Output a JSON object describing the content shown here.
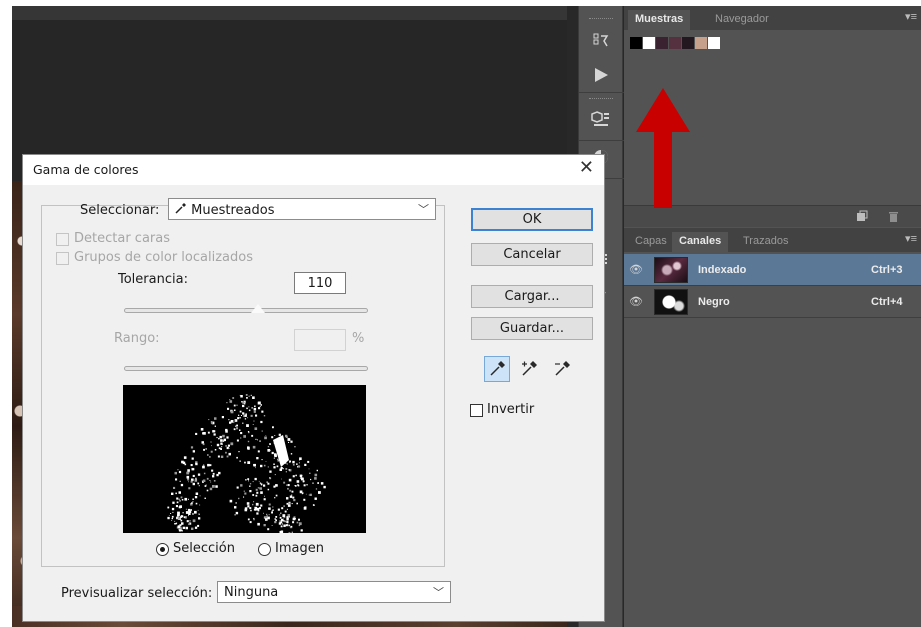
{
  "dialog": {
    "title": "Gama de colores",
    "select_label": "Seleccionar:",
    "select_value": "Muestreados",
    "detect_faces_label": "Detectar caras",
    "local_clusters_label": "Grupos de color localizados",
    "tolerance_label": "Tolerancia:",
    "tolerance_value": "110",
    "tolerance_fraction": 0.55,
    "range_label": "Rango:",
    "range_unit": "%",
    "radio_selection_label": "Selección",
    "radio_image_label": "Imagen",
    "preview_label": "Previsualizar selección:",
    "preview_value": "Ninguna",
    "buttons": {
      "ok": "OK",
      "cancel": "Cancelar",
      "load": "Cargar...",
      "save": "Guardar..."
    },
    "invert_label": "Invertir"
  },
  "swatches_panel": {
    "tabs": [
      "Muestras",
      "Navegador"
    ],
    "colors": [
      "#000000",
      "#ffffff",
      "#3a2230",
      "#55303f",
      "#241820",
      "#c7a08c",
      "#ffffff"
    ]
  },
  "channels_panel": {
    "tabs": [
      "Capas",
      "Canales",
      "Trazados"
    ],
    "rows": [
      {
        "name": "Indexado",
        "shortcut": "Ctrl+3"
      },
      {
        "name": "Negro",
        "shortcut": "Ctrl+4"
      }
    ]
  },
  "colors": {
    "arrow": "#cc0000",
    "selected_row": "#5b7897",
    "ok_border": "#3c82d2"
  }
}
